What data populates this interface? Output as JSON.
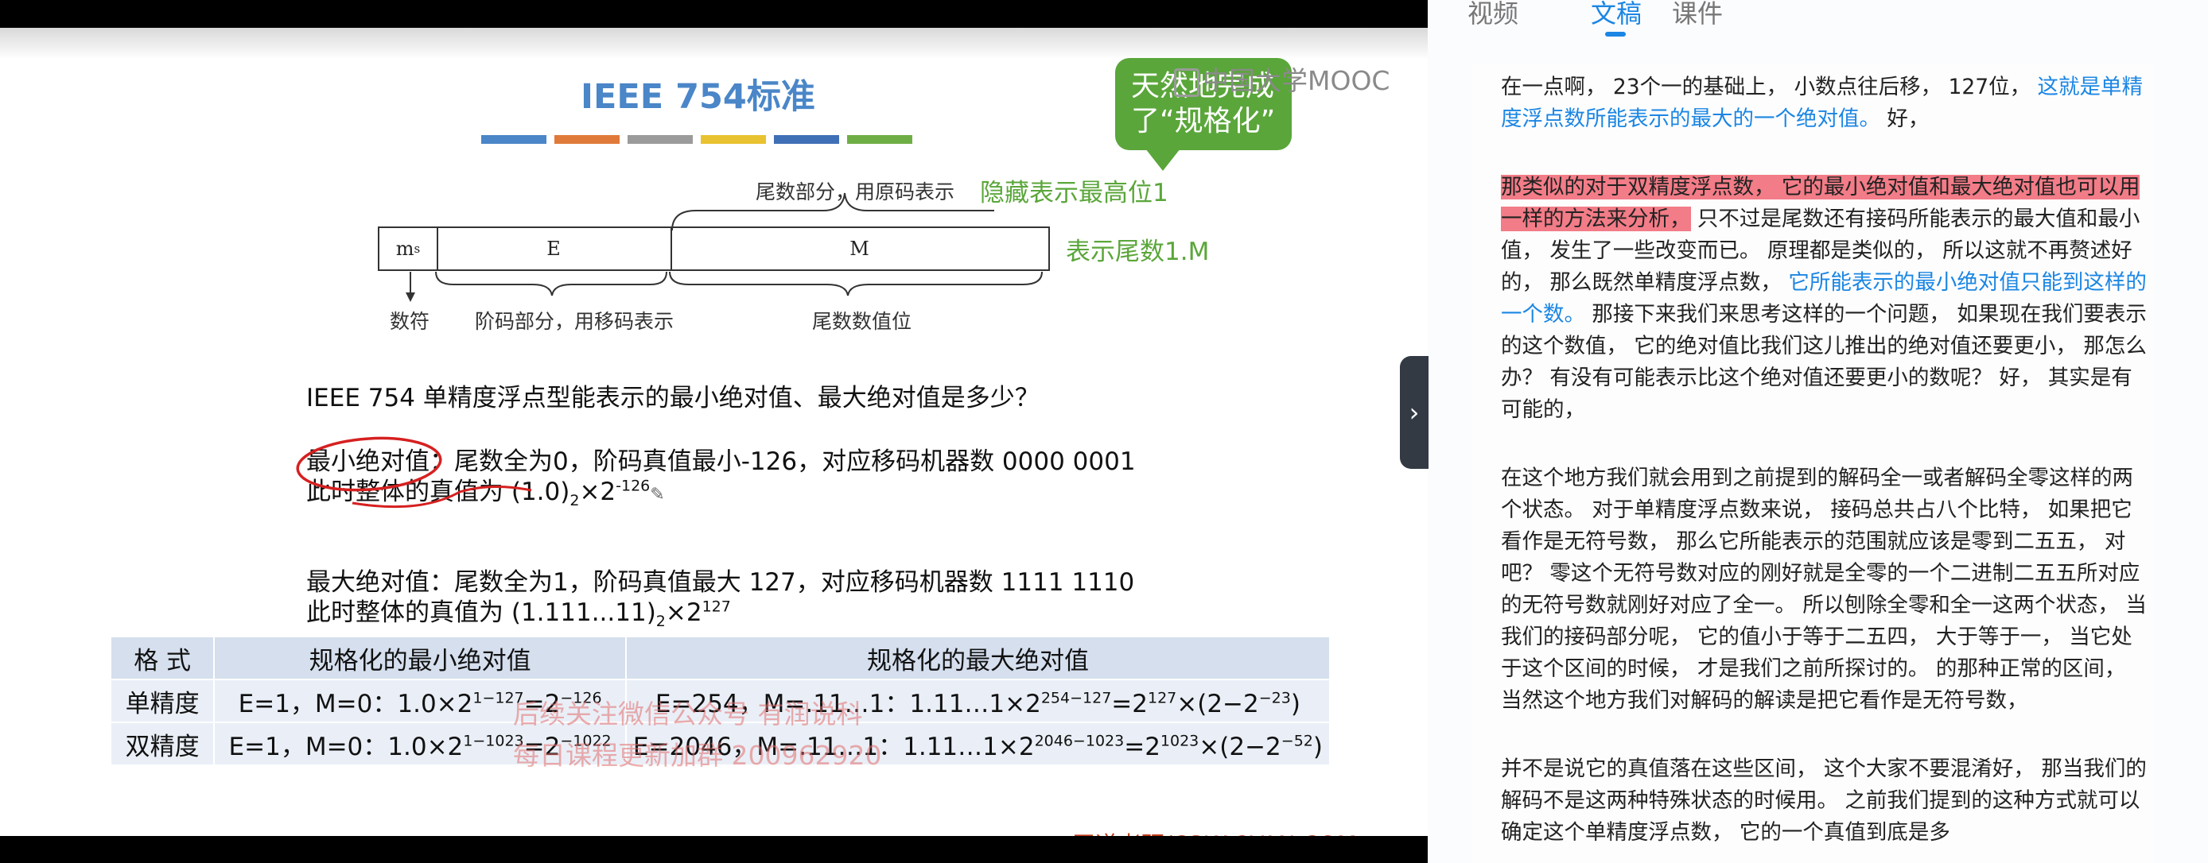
{
  "slide": {
    "title": "IEEE 754标准",
    "color_bars": [
      "#4a86c8",
      "#e07a3a",
      "#9b9b9b",
      "#e8c230",
      "#3f6fb6",
      "#6fae45"
    ],
    "callout": [
      "天然地完成",
      "了“规格化”"
    ],
    "mooc_watermark": "中国大学MOOC",
    "diagram": {
      "mantissa_header": "尾数部分，用原码表示",
      "hidden_bit_note": "隐藏表示最高位1",
      "cell_ms": "m",
      "cell_ms_sub": "s",
      "cell_e": "E",
      "cell_m": "M",
      "mantissa_note": "表示尾数1.M",
      "label_sign": "数符",
      "label_exp": "阶码部分，用移码表示",
      "label_mant": "尾数数值位"
    },
    "question": "IEEE 754 单精度浮点型能表示的最小绝对值、最大绝对值是多少？",
    "min_line1_label": "最小绝对值",
    "min_line1_rest": "：尾数全为0，阶码真值最小-126，对应移码机器数 0000 0001",
    "min_line2": "此时整体的真值为 (1.0)",
    "min_line2_sub": "2",
    "min_line2_times": "×2",
    "min_line2_sup": "-126",
    "max_line1": "最大绝对值：尾数全为1，阶码真值最大 127，对应移码机器数 1111 1110",
    "max_line2": "此时整体的真值为 (1.111...11)",
    "max_line2_sub": "2",
    "max_line2_times": "×2",
    "max_line2_sup": "127",
    "table": {
      "headers": [
        "格  式",
        "规格化的最小绝对值",
        "规格化的最大绝对值"
      ],
      "rows": [
        {
          "format": "单精度",
          "min_pre": "E=1，M=0：1.0×2",
          "min_sup1": "1−127",
          "min_mid": "=2",
          "min_sup2": "−126",
          "max_pre": "E=254，M=.11…1：1.11…1×2",
          "max_sup1": "254−127",
          "max_mid": "=2",
          "max_sup2": "127",
          "max_post": "×(2−2",
          "max_sup3": "−23",
          "max_end": ")"
        },
        {
          "format": "双精度",
          "min_pre": "E=1，M=0：1.0×2",
          "min_sup1": "1−1023",
          "min_mid": "=2",
          "min_sup2": "−1022",
          "max_pre": "E=2046，M=.11…1：1.11…1×2",
          "max_sup1": "2046−1023",
          "max_mid": "=2",
          "max_sup2": "1023",
          "max_post": "×(2−2",
          "max_sup3": "−52",
          "max_end": ")"
        }
      ]
    },
    "ad_watermark": [
      "后续关注微信公众号 有润说科",
      "每日课程更新加群 200962920"
    ],
    "credit": "王道考研/CSKAOYAN.COM"
  },
  "panel": {
    "tabs": [
      {
        "label": "视频",
        "active": false
      },
      {
        "label": "文稿",
        "active": true
      },
      {
        "label": "课件",
        "active": false
      }
    ],
    "collapse_icon": "›",
    "paragraphs": [
      [
        {
          "text": "在一点啊， 23个一的基础上， 小数点往后移， 127位， ",
          "style": "normal"
        },
        {
          "text": "这就是单精度浮点数所能表示的最大的一个绝对值。",
          "style": "blue"
        },
        {
          "text": " 好，",
          "style": "normal"
        }
      ],
      [
        {
          "text": "那类似的对于双精度浮点数， 它的最小绝对值和最大绝对值也可以用一样的方法来分析，",
          "style": "red"
        },
        {
          "text": " 只不过是尾数还有接码所能表示的最大值和最小值， 发生了一些改变而已。 原理都是类似的， 所以这就不再赘述好的， 那么既然单精度浮点数， ",
          "style": "normal"
        },
        {
          "text": "它所能表示的最小绝对值只能到这样的一个数。",
          "style": "blue"
        },
        {
          "text": " 那接下来我们来思考这样的一个问题， 如果现在我们要表示的这个数值， 它的绝对值比我们这儿推出的绝对值还要更小， 那怎么办？ 有没有可能表示比这个绝对值还要更小的数呢？ 好， 其实是有可能的，",
          "style": "normal"
        }
      ],
      [
        {
          "text": "在这个地方我们就会用到之前提到的解码全一或者解码全零这样的两个状态。 对于单精度浮点数来说， 接码总共占八个比特， 如果把它看作是无符号数， 那么它所能表示的范围就应该是零到二五五， 对吧？ 零这个无符号数对应的刚好就是全零的一个二进制二五五所对应的无符号数就刚好对应了全一。 所以刨除全零和全一这两个状态， 当我们的接码部分呢， 它的值小于等于二五四， 大于等于一， 当它处于这个区间的时候， 才是我们之前所探讨的。 的那种正常的区间， 当然这个地方我们对解码的解读是把它看作是无符号数，",
          "style": "normal"
        }
      ],
      [
        {
          "text": "并不是说它的真值落在这些区间， 这个大家不要混淆好， 那当我们的解码不是这两种特殊状态的时候用。 之前我们提到的这种方式就可以确定这个单精度浮点数， 它的一个真值到底是多",
          "style": "normal"
        }
      ]
    ]
  }
}
